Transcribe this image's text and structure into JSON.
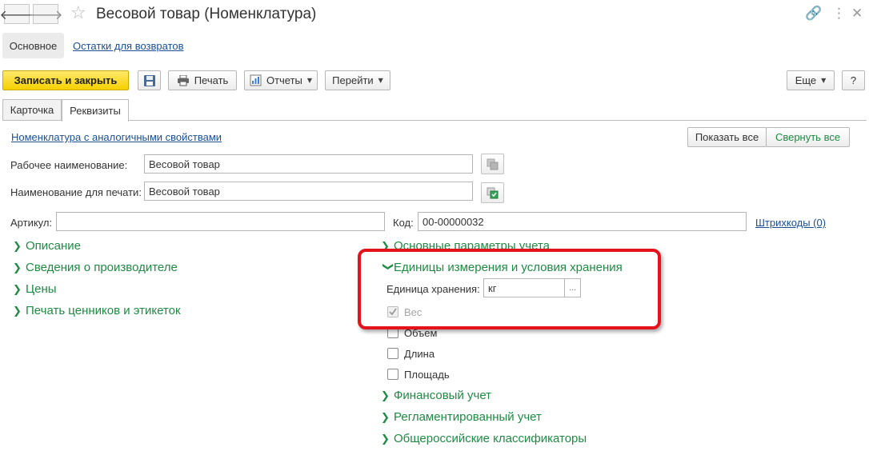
{
  "window": {
    "title": "Весовой товар (Номенклатура)",
    "nav_back_icon": "arrow-left-icon",
    "nav_forward_icon": "arrow-right-icon",
    "favorite_icon": "star-icon",
    "link_icon": "link-icon",
    "menu_icon": "more-vertical-icon",
    "close_icon": "close-icon"
  },
  "section_tabs": {
    "main": "Основное",
    "returns": "Остатки для возвратов"
  },
  "toolbar": {
    "save_close": "Записать и закрыть",
    "print": "Печать",
    "reports": "Отчеты",
    "goto": "Перейти",
    "more": "Еще",
    "help": "?"
  },
  "tabs": {
    "card": "Карточка",
    "props": "Реквизиты"
  },
  "form": {
    "similar_link": "Номенклатура с аналогичными свойствами",
    "show_all": "Показать все",
    "collapse_all": "Свернуть все",
    "work_name_label": "Рабочее наименование:",
    "work_name_value": "Весовой товар",
    "print_name_label": "Наименование для печати:",
    "print_name_value": "Весовой товар",
    "article_label": "Артикул:",
    "article_value": "",
    "code_label": "Код:",
    "code_value": "00-00000032",
    "barcodes_link": "Штрихкоды (0)"
  },
  "left_groups": [
    "Описание",
    "Сведения о производителе",
    "Цены",
    "Печать ценников и этикеток"
  ],
  "right_groups": {
    "accounting_params": "Основные параметры учета",
    "units": "Единицы измерения и условия хранения",
    "storage_unit_label": "Единица хранения:",
    "storage_unit_value": "кг",
    "select_button": "...",
    "weight": "Вес",
    "volume": "Объем",
    "length": "Длина",
    "area": "Площадь",
    "financial": "Финансовый учет",
    "regulated": "Регламентированный учет",
    "classifiers": "Общероссийские классификаторы"
  },
  "colors": {
    "primary_button": "#f6d000",
    "group_green": "#1f8a43",
    "link_blue": "#1a4f95",
    "highlight_red": "#e3121b"
  }
}
